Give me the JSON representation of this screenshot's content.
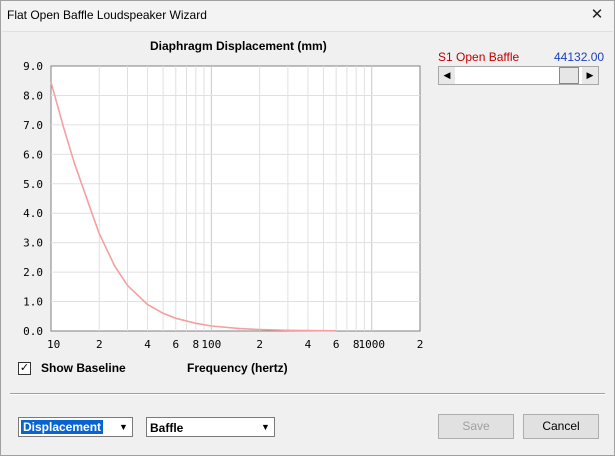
{
  "window": {
    "title": "Flat Open Baffle Loudspeaker Wizard",
    "close_glyph": "✕"
  },
  "slider": {
    "label": "S1  Open Baffle",
    "value": "44132.00",
    "left_arrow": "◀",
    "right_arrow": "▶",
    "position_fraction": 0.97
  },
  "controls": {
    "show_baseline_checked": true,
    "checkbox_glyph": "✓",
    "show_baseline_label": "Show Baseline",
    "frequency_label": "Frequency (hertz)",
    "mode_combo_value": "Displacement",
    "type_combo_value": "Baffle",
    "combo_arrow": "▼",
    "save_label": "Save",
    "cancel_label": "Cancel"
  },
  "chart_data": {
    "type": "line",
    "title": "Diaphragm Displacement (mm)",
    "xlabel": "Frequency (hertz)",
    "ylabel": "",
    "x_scale": "log",
    "xlim": [
      10,
      2000
    ],
    "ylim": [
      0,
      9
    ],
    "grid": true,
    "y_ticks": [
      "0.0",
      "1.0",
      "2.0",
      "3.0",
      "4.0",
      "5.0",
      "6.0",
      "7.0",
      "8.0",
      "9.0"
    ],
    "x_ticks": [
      {
        "value": 10,
        "label": "10"
      },
      {
        "value": 20,
        "label": "2"
      },
      {
        "value": 40,
        "label": "4"
      },
      {
        "value": 60,
        "label": "6"
      },
      {
        "value": 80,
        "label": "8"
      },
      {
        "value": 100,
        "label": "100"
      },
      {
        "value": 200,
        "label": "2"
      },
      {
        "value": 400,
        "label": "4"
      },
      {
        "value": 600,
        "label": "6"
      },
      {
        "value": 800,
        "label": "8"
      },
      {
        "value": 1000,
        "label": "1000"
      },
      {
        "value": 2000,
        "label": "2"
      }
    ],
    "series": [
      {
        "color": "#f4a0a0",
        "x": [
          10,
          12,
          14,
          16,
          18,
          20,
          25,
          30,
          40,
          50,
          60,
          80,
          100,
          150,
          200,
          300,
          400,
          500,
          600
        ],
        "y": [
          8.45,
          6.9,
          5.7,
          4.8,
          4.0,
          3.3,
          2.2,
          1.55,
          0.9,
          0.6,
          0.43,
          0.26,
          0.17,
          0.08,
          0.05,
          0.025,
          0.015,
          0.01,
          0.008
        ]
      }
    ]
  }
}
